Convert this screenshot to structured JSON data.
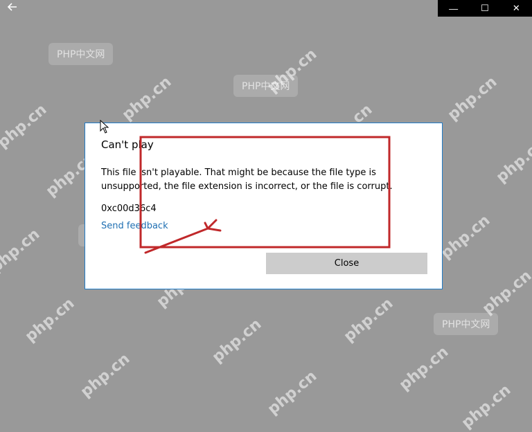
{
  "titlebar": {
    "back_icon": "arrow-left-icon",
    "minimize": "—",
    "maximize": "☐",
    "close": "✕"
  },
  "dialog": {
    "title": "Can't play",
    "message": "This file isn't playable. That might be because the file type is unsupported, the file extension is incorrect, or the file is corrupt.",
    "error_code": "0xc00d36c4",
    "feedback_link": "Send feedback",
    "close_button": "Close"
  },
  "watermarks": {
    "site": "php.cn",
    "badge": "PHP中文网"
  },
  "colors": {
    "background": "#999999",
    "dialog_border": "#1f7bc8",
    "link": "#1f6fb2",
    "annotation_red": "#c0282a"
  }
}
